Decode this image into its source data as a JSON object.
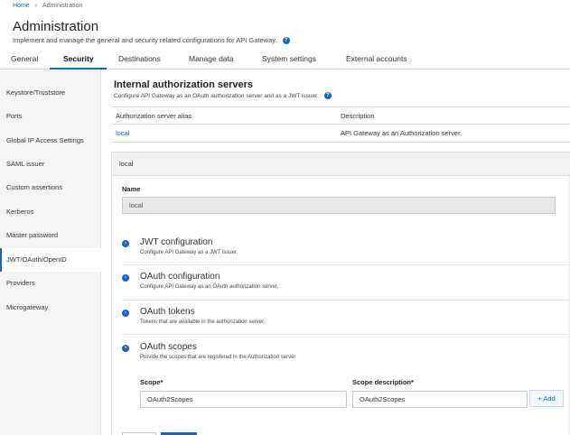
{
  "breadcrumb": {
    "home": "Home",
    "separator": "›",
    "current": "Administration"
  },
  "page": {
    "title": "Administration",
    "subtitle": "Implement and manage the general and security related configurations for API Gateway."
  },
  "tabs": [
    "General",
    "Security",
    "Destinations",
    "Manage data",
    "System settings",
    "External accounts"
  ],
  "active_tab": "Security",
  "sidebar": {
    "items": [
      "Keystore/Truststore",
      "Ports",
      "Global IP Access Settings",
      "SAML issuer",
      "Custom assertions",
      "Kerberos",
      "Master password",
      "JWT/OAuth/OpenID",
      "Providers",
      "Microgateway"
    ],
    "active": "JWT/OAuth/OpenID"
  },
  "section": {
    "title": "Internal authorization servers",
    "subtitle": "Configure API Gateway as an OAuth authorization server and as a JWT issuer."
  },
  "table": {
    "columns": [
      "Authorization server alias",
      "Description"
    ],
    "rows": [
      {
        "alias": "local",
        "description": "API Gateway as an Authorization server."
      }
    ]
  },
  "detail": {
    "header": "local",
    "name_label": "Name",
    "name_value": "local"
  },
  "accordions": [
    {
      "title": "JWT configuration",
      "desc": "Configure API Gateway as a JWT issuer.",
      "icon": "chevron-right-icon"
    },
    {
      "title": "OAuth configuration",
      "desc": "Configure API Gateway as an OAuth authorization server.",
      "icon": "chevron-right-icon"
    },
    {
      "title": "OAuth tokens",
      "desc": "Tokens that are available in the authorization server.",
      "icon": "chevron-right-icon"
    },
    {
      "title": "OAuth scopes",
      "desc": "Provide the scopes that are registered in the Authorization server",
      "icon": "chevron-down-icon"
    }
  ],
  "scopes": {
    "scope_label": "Scope*",
    "scope_value": "OAuth2Scopes",
    "desc_label": "Scope description*",
    "desc_value": "OAuth2Scopes",
    "add_label": "+ Add"
  },
  "colors": {
    "accent": "#1565c0",
    "sidebar_bg": "#f5f5f5"
  }
}
